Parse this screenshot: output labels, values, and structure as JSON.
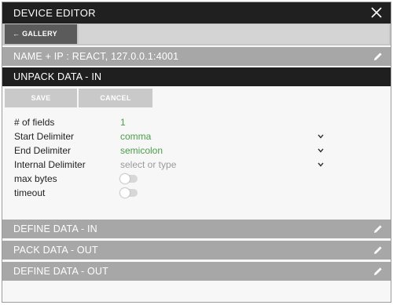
{
  "window": {
    "title": "DEVICE EDITOR",
    "close_icon": "close-icon"
  },
  "nav": {
    "back_label": "← GALLERY"
  },
  "sections": {
    "name_ip": "NAME + IP : REACT, 127.0.0.1:4001",
    "unpack_in": "UNPACK DATA - IN",
    "define_in": "DEFINE DATA - IN",
    "pack_out": "PACK DATA - OUT",
    "define_out": "DEFINE DATA - OUT"
  },
  "buttons": {
    "save": "SAVE",
    "cancel": "CANCEL"
  },
  "fields": {
    "num_fields": {
      "label": "# of fields",
      "value": "1"
    },
    "start_delimiter": {
      "label": "Start Delimiter",
      "value": "comma"
    },
    "end_delimiter": {
      "label": "End Delimiter",
      "value": "semicolon"
    },
    "internal_delimiter": {
      "label": "Internal Delimiter",
      "placeholder": "select or type"
    },
    "max_bytes": {
      "label": "max bytes",
      "enabled": false
    },
    "timeout": {
      "label": "timeout",
      "enabled": false
    }
  },
  "colors": {
    "titlebar": "#202020",
    "active_section": "#1f1f1f",
    "section": "#a7a7a7",
    "value_green": "#4a9d4a",
    "placeholder": "#9a9a9a"
  },
  "icons": {
    "edit": "pencil-icon",
    "chevron": "chevron-down-icon",
    "close": "close-icon"
  }
}
